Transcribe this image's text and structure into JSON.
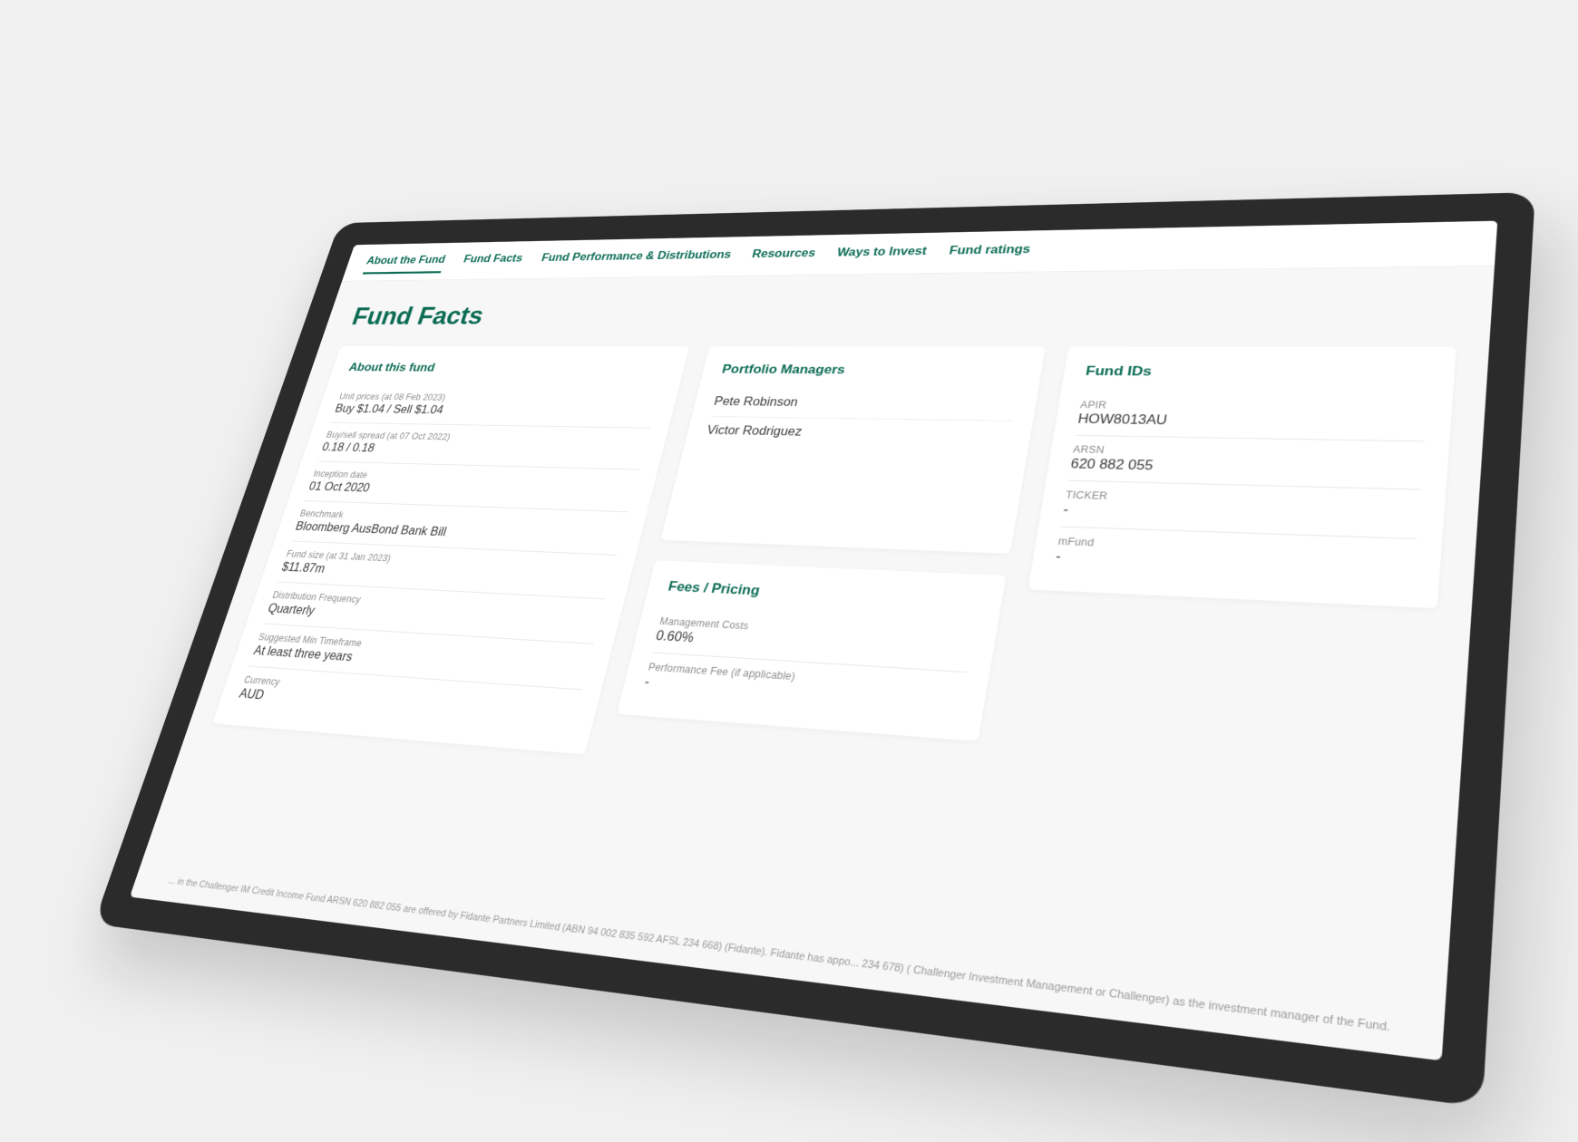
{
  "tabs": [
    {
      "label": "About the Fund",
      "active": true
    },
    {
      "label": "Fund Facts",
      "active": false
    },
    {
      "label": "Fund Performance & Distributions",
      "active": false
    },
    {
      "label": "Resources",
      "active": false
    },
    {
      "label": "Ways to Invest",
      "active": false
    },
    {
      "label": "Fund ratings",
      "active": false
    }
  ],
  "page_title": "Fund Facts",
  "about": {
    "heading": "About this fund",
    "rows": [
      {
        "label": "Unit prices (at 08 Feb 2023)",
        "value": "Buy $1.04 / Sell $1.04"
      },
      {
        "label": "Buy/sell spread (at 07 Oct 2022)",
        "value": "0.18 / 0.18"
      },
      {
        "label": "Inception date",
        "value": "01 Oct 2020"
      },
      {
        "label": "Benchmark",
        "value": "Bloomberg AusBond Bank Bill"
      },
      {
        "label": "Fund size (at 31 Jan 2023)",
        "value": "$11.87m"
      },
      {
        "label": "Distribution Frequency",
        "value": "Quarterly"
      },
      {
        "label": "Suggested Min Timeframe",
        "value": "At least three years"
      },
      {
        "label": "Currency",
        "value": "AUD"
      }
    ]
  },
  "managers": {
    "heading": "Portfolio Managers",
    "list": [
      "Pete Robinson",
      "Victor Rodriguez"
    ]
  },
  "fees": {
    "heading": "Fees / Pricing",
    "rows": [
      {
        "label": "Management Costs",
        "value": "0.60%"
      },
      {
        "label": "Performance Fee (if applicable)",
        "value": "-"
      }
    ]
  },
  "ids": {
    "heading": "Fund IDs",
    "rows": [
      {
        "label": "APIR",
        "value": "HOW8013AU"
      },
      {
        "label": "ARSN",
        "value": "620 882 055"
      },
      {
        "label": "TICKER",
        "value": "-"
      },
      {
        "label": "mFund",
        "value": "-"
      }
    ]
  },
  "disclaimer": "... in the Challenger IM Credit Income Fund ARSN 620 882 055 are offered by Fidante Partners Limited (ABN 94 002 835 592 AFSL 234 668) (Fidante). Fidante has appo... 234 678) ( Challenger Investment Management or Challenger) as the investment manager of the Fund."
}
